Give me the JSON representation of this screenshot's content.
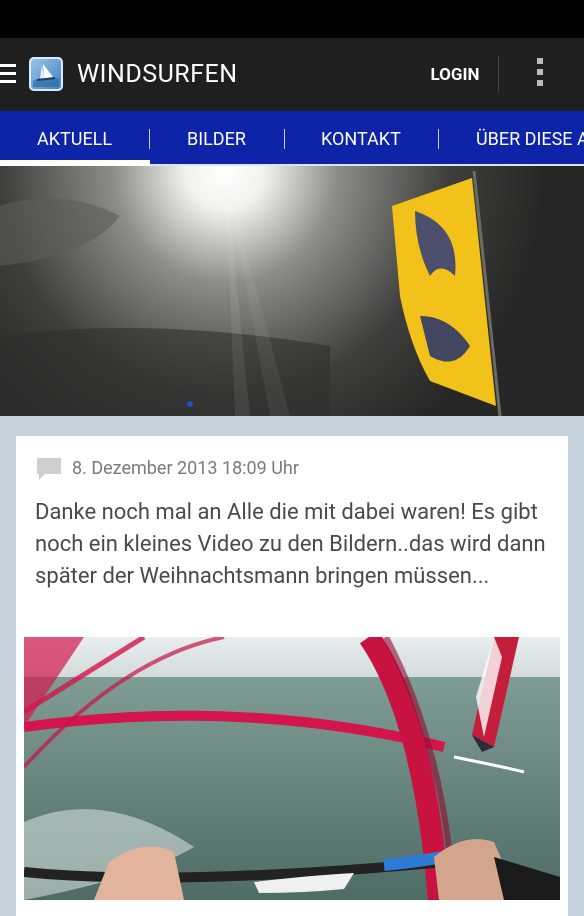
{
  "app": {
    "title": "WINDSURFEN",
    "login_label": "LOGIN"
  },
  "icons": {
    "menu": "hamburger-menu-icon",
    "logo": "windsurf-app-logo",
    "overflow": "overflow-menu-icon",
    "comment": "comment-icon"
  },
  "tabs": [
    {
      "label": "AKTUELL",
      "selected": true
    },
    {
      "label": "BILDER",
      "selected": false
    },
    {
      "label": "KONTAKT",
      "selected": false
    },
    {
      "label": "ÜBER DIESE APP",
      "selected": false
    }
  ],
  "post": {
    "date": "8. Dezember 2013 18:09 Uhr",
    "text": "Danke noch mal an Alle die mit dabei waren! Es gibt noch ein kleines Video zu den Bildern..das wird dann später der Weihnachtsmann bringen müssen..."
  },
  "colors": {
    "tabbar": "#0d23a8",
    "actionbar": "#1f1f1f",
    "background": "#c5d2dc"
  }
}
